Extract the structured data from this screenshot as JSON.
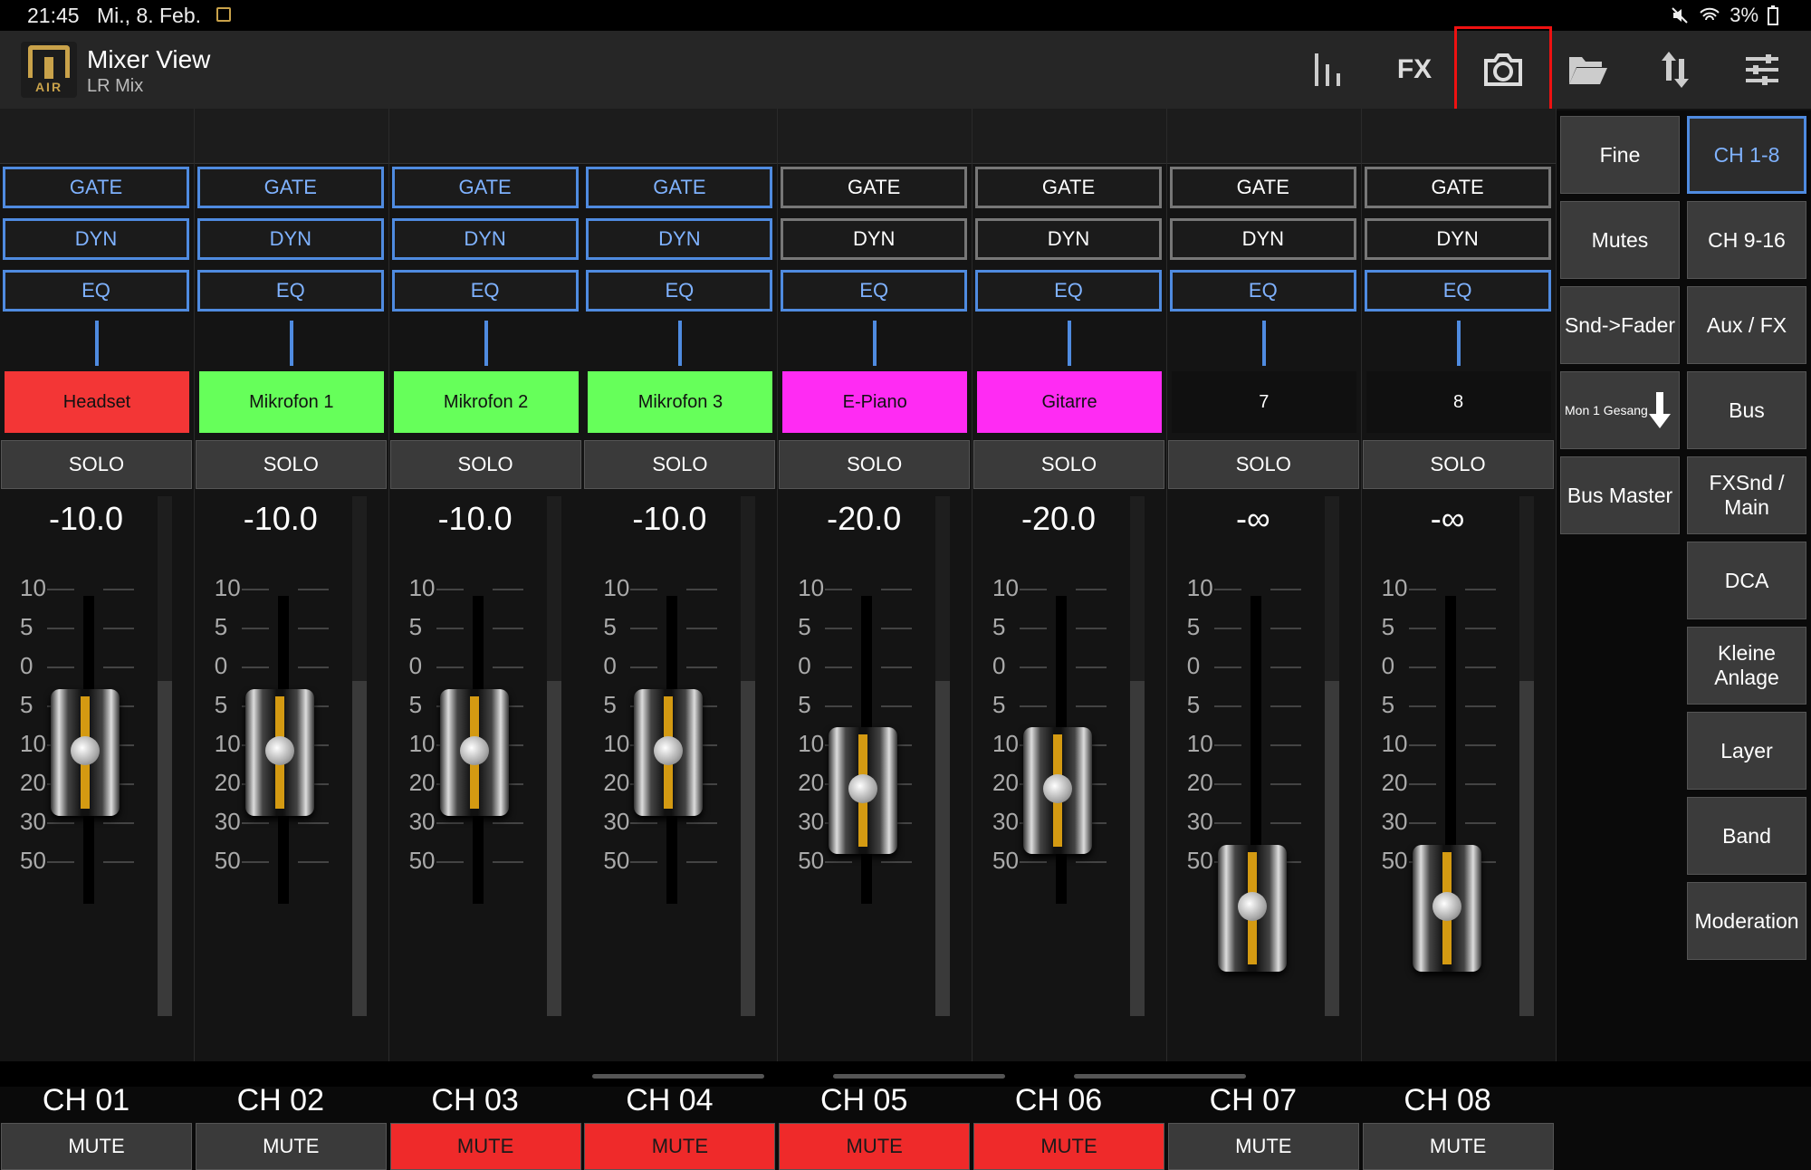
{
  "status": {
    "time": "21:45",
    "date": "Mi., 8. Feb.",
    "battery": "3%"
  },
  "app": {
    "title": "Mixer View",
    "subtitle": "LR Mix",
    "logo_text": "AIR"
  },
  "toolbar": {
    "fx_label": "FX",
    "icons": [
      "meters-icon",
      "fx",
      "camera-icon",
      "folder-icon",
      "transfer-icon",
      "sliders-icon"
    ]
  },
  "buttons": {
    "gate": "GATE",
    "dyn": "DYN",
    "eq": "EQ",
    "solo": "SOLO",
    "mute": "MUTE"
  },
  "scale": [
    "10",
    "5",
    "0",
    "5",
    "10",
    "20",
    "30",
    "50"
  ],
  "channels": [
    {
      "name": "Headset",
      "color": "#f33636",
      "level": "-10.0",
      "label": "CH 01",
      "gate_on": true,
      "dyn_on": true,
      "muted": false,
      "fader": 0.0
    },
    {
      "name": "Mikrofon 1",
      "color": "#66ff5a",
      "level": "-10.0",
      "label": "CH 02",
      "gate_on": true,
      "dyn_on": true,
      "muted": false,
      "fader": 0.0
    },
    {
      "name": "Mikrofon 2",
      "color": "#66ff5a",
      "level": "-10.0",
      "label": "CH 03",
      "gate_on": true,
      "dyn_on": true,
      "muted": true,
      "fader": 0.0
    },
    {
      "name": "Mikrofon 3",
      "color": "#66ff5a",
      "level": "-10.0",
      "label": "CH 04",
      "gate_on": true,
      "dyn_on": true,
      "muted": true,
      "fader": 0.0
    },
    {
      "name": "E-Piano",
      "color": "#ff2bf3",
      "level": "-20.0",
      "label": "CH 05",
      "gate_on": false,
      "dyn_on": false,
      "muted": true,
      "fader": 1.0
    },
    {
      "name": "Gitarre",
      "color": "#ff2bf3",
      "level": "-20.0",
      "label": "CH 06",
      "gate_on": false,
      "dyn_on": false,
      "muted": true,
      "fader": 1.0
    },
    {
      "name": "7",
      "color": "#101010",
      "level": "-∞",
      "label": "CH 07",
      "gate_on": false,
      "dyn_on": false,
      "muted": false,
      "fader": 2.0
    },
    {
      "name": "8",
      "color": "#101010",
      "level": "-∞",
      "label": "CH 08",
      "gate_on": false,
      "dyn_on": false,
      "muted": false,
      "fader": 2.0
    }
  ],
  "right_col1": [
    "Fine",
    "Mutes",
    "Snd->Fader",
    "Mon 1 Gesang",
    "Bus Master"
  ],
  "right_col2": [
    "CH 1-8",
    "CH 9-16",
    "Aux / FX",
    "Bus",
    "FXSnd / Main",
    "DCA",
    "Kleine Anlage",
    "Layer",
    "Band",
    "Moderation"
  ]
}
